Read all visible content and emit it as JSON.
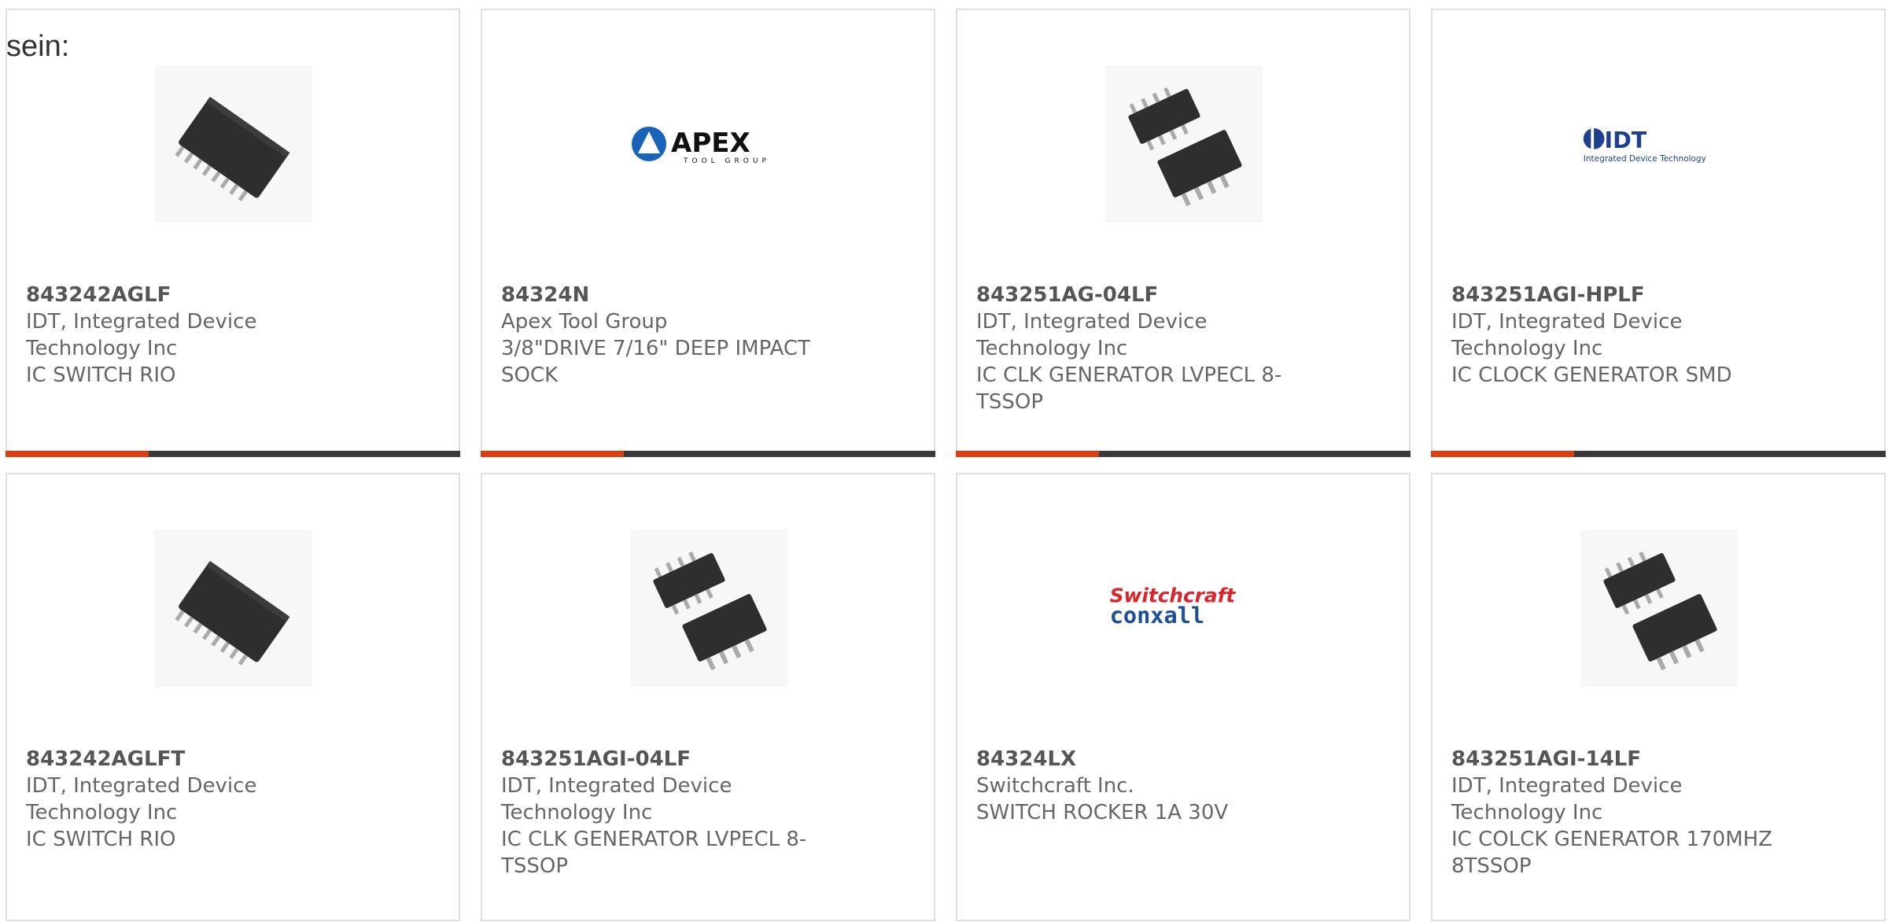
{
  "page": {
    "prefix_text": "sein:"
  },
  "colors": {
    "accent": "#e03c0f",
    "bar": "#3a3a3a",
    "border": "#e0e0e0",
    "text": "#666666"
  },
  "products": [
    {
      "part_number": "843242AGLF",
      "manufacturer": "IDT, Integrated Device Technology Inc",
      "description": "IC SWITCH RIO",
      "image": "chip-tssop16-image"
    },
    {
      "part_number": "84324N",
      "manufacturer": "Apex Tool Group",
      "description": "3/8\"DRIVE 7/16\" DEEP IMPACT SOCK",
      "image": "apex-logo",
      "logo_text": "APEX",
      "logo_subtext": "TOOL GROUP"
    },
    {
      "part_number": "843251AG-04LF",
      "manufacturer": "IDT, Integrated Device Technology Inc",
      "description": "IC CLK GENERATOR LVPECL 8-TSSOP",
      "image": "chip-tssop8-image"
    },
    {
      "part_number": "843251AGI-HPLF",
      "manufacturer": "IDT, Integrated Device Technology Inc",
      "description": "IC CLOCK GENERATOR SMD",
      "image": "idt-logo",
      "logo_text": "IDT",
      "logo_subtext": "Integrated Device Technology"
    },
    {
      "part_number": "843242AGLFT",
      "manufacturer": "IDT, Integrated Device Technology Inc",
      "description": "IC SWITCH RIO",
      "image": "chip-tssop16-image"
    },
    {
      "part_number": "843251AGI-04LF",
      "manufacturer": "IDT, Integrated Device Technology Inc",
      "description": "IC CLK GENERATOR LVPECL 8-TSSOP",
      "image": "chip-tssop8-image"
    },
    {
      "part_number": "84324LX",
      "manufacturer": "Switchcraft Inc.",
      "description": "SWITCH ROCKER 1A 30V",
      "image": "switchcraft-logo",
      "logo_text": "Switchcraft",
      "logo_subtext": "conxall"
    },
    {
      "part_number": "843251AGI-14LF",
      "manufacturer": "IDT, Integrated Device Technology Inc",
      "description": "IC COLCK GENERATOR 170MHZ 8TSSOP",
      "image": "chip-tssop8-image"
    }
  ]
}
